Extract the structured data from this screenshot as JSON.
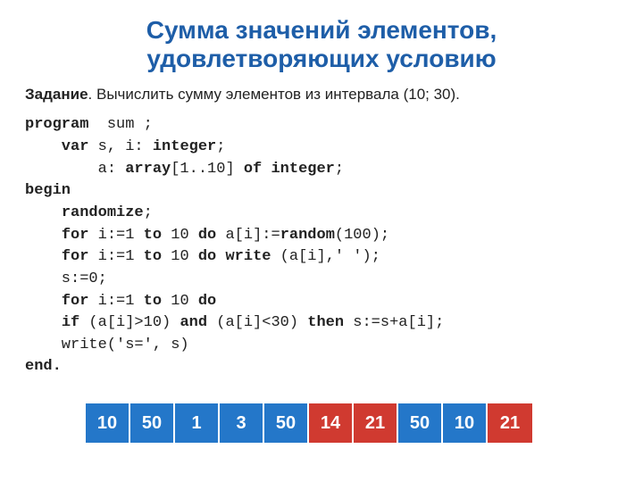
{
  "title_line1": "Сумма значений элементов,",
  "title_line2": "удовлетворяющих условию",
  "task_label": "Задание",
  "task_text": ". Вычислить сумму элементов из интервала (10; 30).",
  "code": {
    "l1a": "program",
    "l1b": "  sum ;",
    "l2a": "    var",
    "l2b": " s, i: ",
    "l2c": "integer",
    "l2d": ";",
    "l3a": "        a: ",
    "l3b": "array",
    "l3c": "[1..10] ",
    "l3d": "of integer",
    "l3e": ";",
    "l4": "begin",
    "l5a": "    ",
    "l5b": "randomize",
    "l5c": ";",
    "l6a": "    ",
    "l6b": "for",
    "l6c": " i:=1 ",
    "l6d": "to",
    "l6e": " 10 ",
    "l6f": "do",
    "l6g": " a[i]:=",
    "l6h": "random",
    "l6i": "(100);",
    "l7a": "    ",
    "l7b": "for",
    "l7c": " i:=1 ",
    "l7d": "to",
    "l7e": " 10 ",
    "l7f": "do write",
    "l7g": " (a[i],' ');",
    "l8": "    s:=0;",
    "l9a": "    ",
    "l9b": "for",
    "l9c": " i:=1 ",
    "l9d": "to",
    "l9e": " 10 ",
    "l9f": "do",
    "l10a": "    ",
    "l10b": "if",
    "l10c": " (a[i]>10) ",
    "l10d": "and",
    "l10e": " (a[i]<30) ",
    "l10f": "then",
    "l10g": " s:=s+a[i];",
    "l11": "    write('s=', s)",
    "l12": "end."
  },
  "cells": [
    {
      "v": "10",
      "c": "blue"
    },
    {
      "v": "50",
      "c": "blue"
    },
    {
      "v": "1",
      "c": "blue"
    },
    {
      "v": "3",
      "c": "blue"
    },
    {
      "v": "50",
      "c": "blue"
    },
    {
      "v": "14",
      "c": "red"
    },
    {
      "v": "21",
      "c": "red"
    },
    {
      "v": "50",
      "c": "blue"
    },
    {
      "v": "10",
      "c": "blue"
    },
    {
      "v": "21",
      "c": "red"
    }
  ]
}
